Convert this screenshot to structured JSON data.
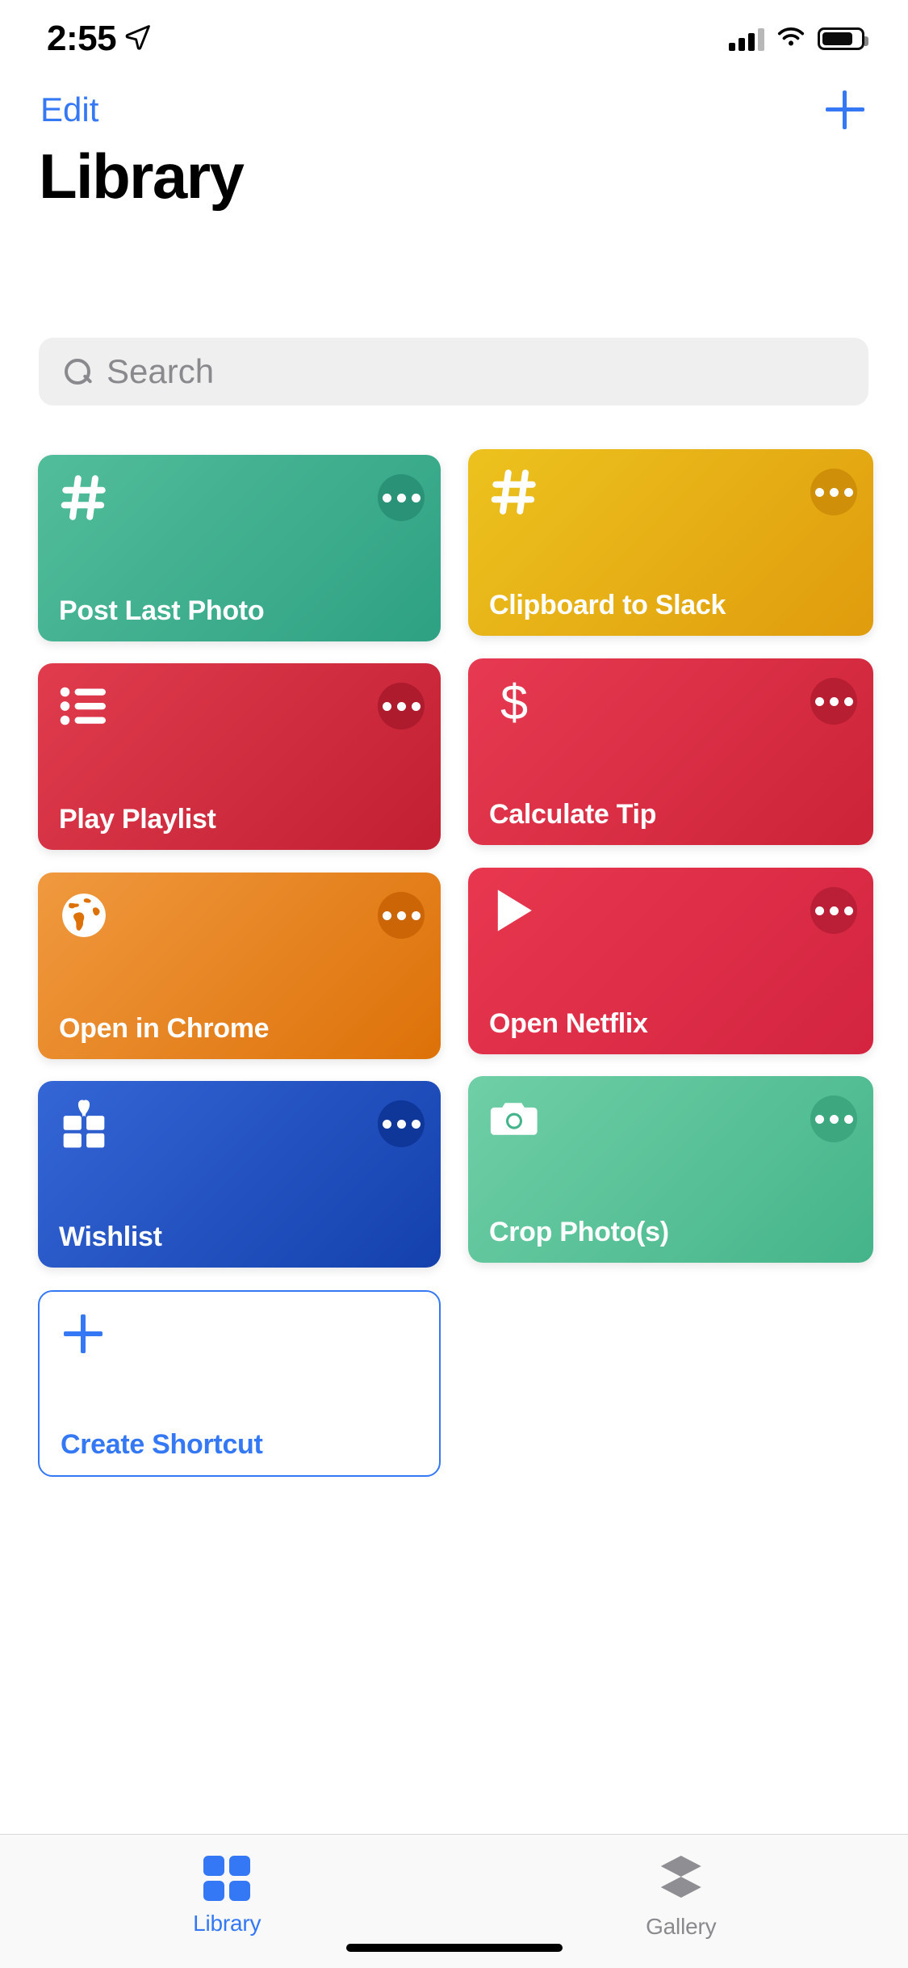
{
  "status_bar": {
    "time": "2:55",
    "location_icon": "location-arrow-icon",
    "cellular_icon": "cellular-signal-icon",
    "wifi_icon": "wifi-icon",
    "battery_icon": "battery-icon"
  },
  "nav": {
    "edit_label": "Edit",
    "add_icon": "plus-icon"
  },
  "header": {
    "title": "Library"
  },
  "search": {
    "placeholder": "Search",
    "value": "",
    "icon": "search-icon"
  },
  "shortcuts": [
    {
      "label": "Post Last Photo",
      "icon": "hashtag-icon",
      "color_start": "#52bd9a",
      "color_end": "#2ea183",
      "dots_color": "#2a9277"
    },
    {
      "label": "Clipboard to Slack",
      "icon": "hashtag-icon",
      "color_start": "#ecc21e",
      "color_end": "#e09c0d",
      "dots_color": "#cf8f08"
    },
    {
      "label": "Play Playlist",
      "icon": "bulleted-list-icon",
      "color_start": "#e03c4e",
      "color_end": "#c21f33",
      "dots_color": "#ae1b2d"
    },
    {
      "label": "Calculate Tip",
      "icon": "dollar-sign-icon",
      "color_start": "#e73a52",
      "color_end": "#cc2338",
      "dots_color": "#b81e31"
    },
    {
      "label": "Open in Chrome",
      "icon": "globe-icon",
      "color_start": "#f0993f",
      "color_end": "#dd7108",
      "dots_color": "#cb6506"
    },
    {
      "label": "Open Netflix",
      "icon": "play-triangle-icon",
      "color_start": "#e8374f",
      "color_end": "#d32440",
      "dots_color": "#bb1f38"
    },
    {
      "label": "Wishlist",
      "icon": "gift-icon",
      "color_start": "#3566d6",
      "color_end": "#1340ac",
      "dots_color": "#0f3699"
    },
    {
      "label": "Crop Photo(s)",
      "icon": "camera-icon",
      "color_start": "#6fcfa6",
      "color_end": "#45b48a",
      "dots_color": "#3da87f"
    }
  ],
  "create_shortcut": {
    "label": "Create Shortcut",
    "icon": "plus-icon",
    "accent_color": "#3478f6"
  },
  "tab_bar": {
    "items": [
      {
        "label": "Library",
        "icon": "grid-squares-icon",
        "active": true
      },
      {
        "label": "Gallery",
        "icon": "layers-icon",
        "active": false
      }
    ],
    "active_color": "#3478f6",
    "inactive_color": "#8e8e93"
  }
}
